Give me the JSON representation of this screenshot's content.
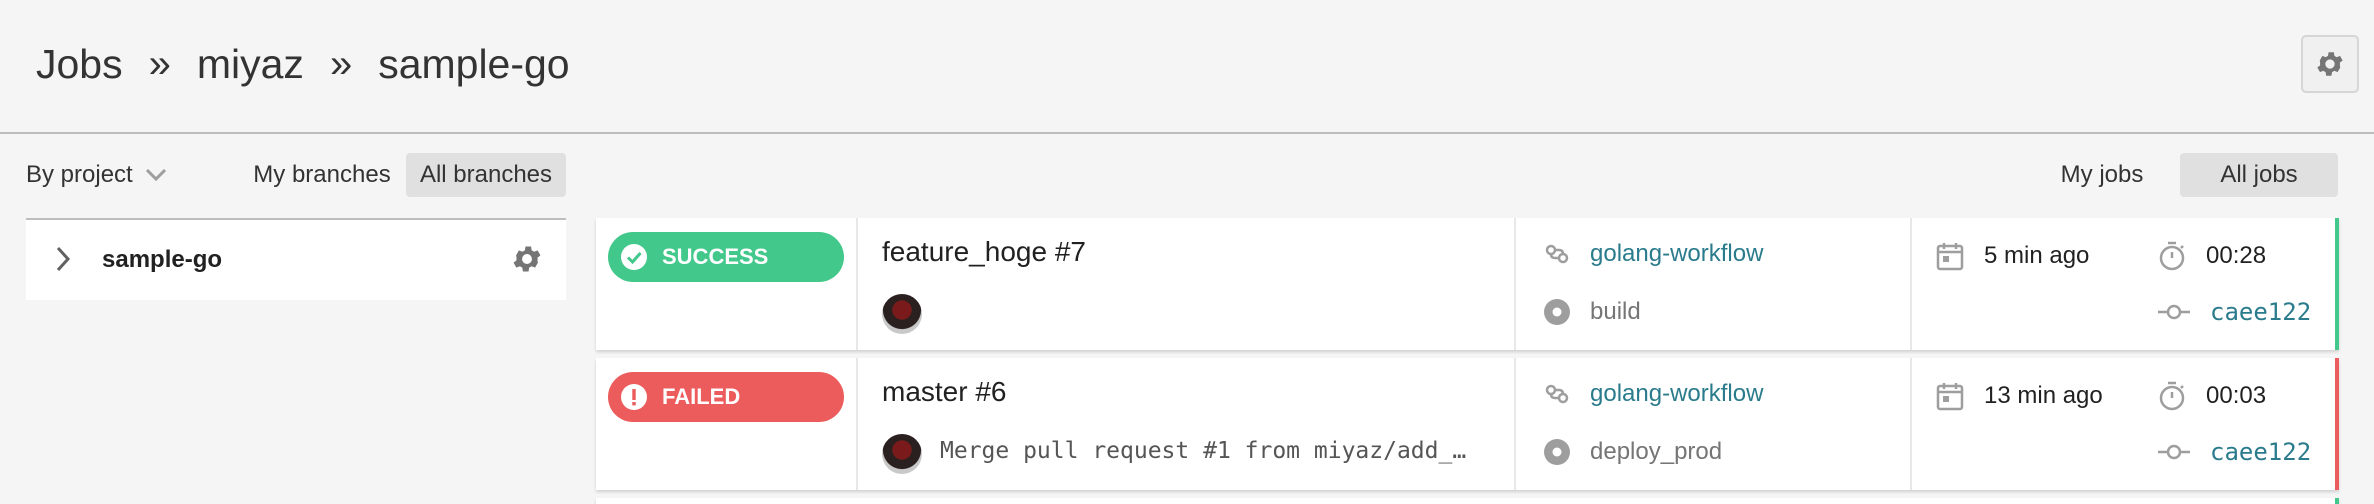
{
  "breadcrumb": {
    "root": "Jobs",
    "sep": "»",
    "org": "miyaz",
    "project": "sample-go"
  },
  "filters": {
    "by_project_label": "By project",
    "my_branches": "My branches",
    "all_branches": "All branches",
    "my_jobs": "My jobs",
    "all_jobs": "All jobs"
  },
  "sidebar": {
    "project_name": "sample-go"
  },
  "colors": {
    "success": "#42c88a",
    "failed": "#ed5c5c",
    "link": "#2a7b8c"
  },
  "jobs": [
    {
      "status": "SUCCESS",
      "title": "feature_hoge #7",
      "commit_message": "",
      "workflow": "golang-workflow",
      "job_name": "build",
      "time_ago": "5 min ago",
      "duration": "00:28",
      "sha": "caee122"
    },
    {
      "status": "FAILED",
      "title": "master #6",
      "commit_message": "Merge pull request #1 from miyaz/add_…",
      "workflow": "golang-workflow",
      "job_name": "deploy_prod",
      "time_ago": "13 min ago",
      "duration": "00:03",
      "sha": "caee122"
    }
  ]
}
